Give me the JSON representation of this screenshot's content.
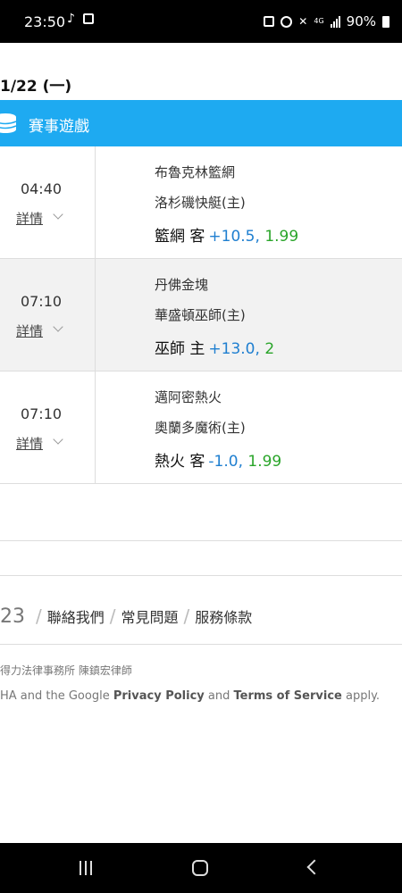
{
  "status_bar": {
    "time": "23:50",
    "battery": "90%",
    "network": "4G"
  },
  "date_header": "1/22 (一)",
  "section": {
    "title": "賽事遊戲",
    "color": "#1eaaf1"
  },
  "games": [
    {
      "time": "04:40",
      "details": "詳情",
      "away": "布魯克林籃網",
      "home": "洛杉磯快艇(主)",
      "pick": "籃網 客",
      "line": "+10.5,",
      "odds": "1.99"
    },
    {
      "time": "07:10",
      "details": "詳情",
      "away": "丹佛金塊",
      "home": "華盛頓巫師(主)",
      "pick": "巫師 主",
      "line": "+13.0,",
      "odds": "2"
    },
    {
      "time": "07:10",
      "details": "詳情",
      "away": "邁阿密熱火",
      "home": "奧蘭多魔術(主)",
      "pick": "熱火 客",
      "line": "-1.0,",
      "odds": "1.99"
    }
  ],
  "footer": {
    "year_fragment": "23",
    "links": [
      "聯絡我們",
      "常見問題",
      "服務條款"
    ],
    "law_firm": "得力法律事務所 陳鎮宏律師",
    "captcha_prefix": "HA and the Google",
    "privacy": "Privacy Policy",
    "and": "and",
    "terms": "Terms of Service",
    "apply": "apply."
  }
}
